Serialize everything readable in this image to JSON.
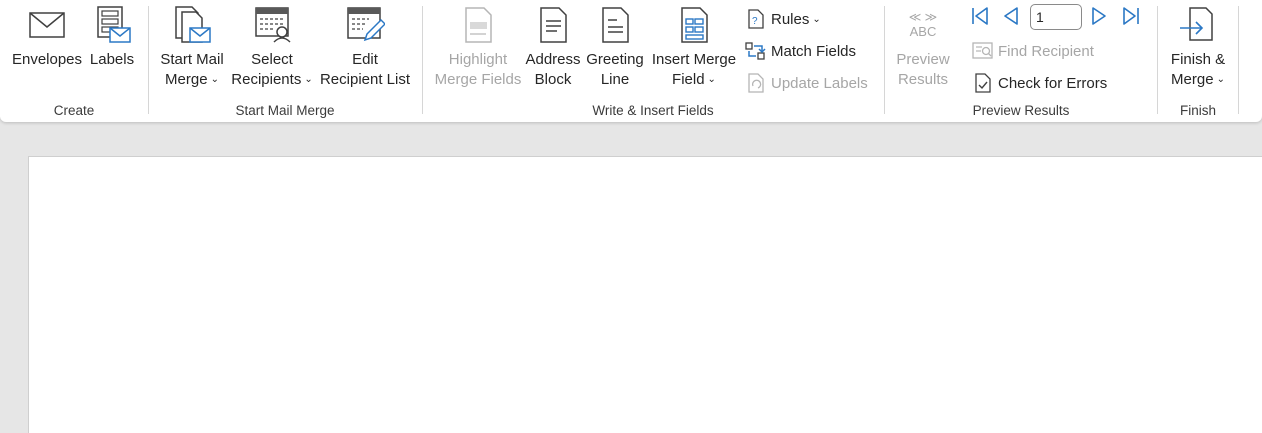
{
  "groups": {
    "create": {
      "label": "Create",
      "envelopes": [
        "Envelopes"
      ],
      "labels": [
        "Labels"
      ]
    },
    "start_mail_merge": {
      "label": "Start Mail Merge",
      "start_mail_merge": [
        "Start Mail",
        "Merge"
      ],
      "select_recipients": [
        "Select",
        "Recipients"
      ],
      "edit_recipient_list": [
        "Edit",
        "Recipient List"
      ]
    },
    "write_insert": {
      "label": "Write & Insert Fields",
      "highlight_merge_fields": [
        "Highlight",
        "Merge Fields"
      ],
      "address_block": [
        "Address",
        "Block"
      ],
      "greeting_line": [
        "Greeting",
        "Line"
      ],
      "insert_merge_field": [
        "Insert Merge",
        "Field"
      ],
      "rules": "Rules",
      "match_fields": "Match Fields",
      "update_labels": "Update Labels"
    },
    "preview_results": {
      "label": "Preview Results",
      "preview_glyph": "≪ ≫",
      "preview_abc": "ABC",
      "preview_results": [
        "Preview",
        "Results"
      ],
      "record_number": "1",
      "find_recipient": "Find Recipient",
      "check_for_errors": "Check for Errors"
    },
    "finish": {
      "label": "Finish",
      "finish_merge": [
        "Finish &",
        "Merge"
      ]
    }
  },
  "colors": {
    "accent": "#2b78c5",
    "disabled": "#a6a6a6",
    "text": "#262626"
  },
  "icons": {
    "envelopes": "envelope-icon",
    "labels": "labels-icon",
    "start_mail_merge": "start-mail-merge-icon",
    "select_recipients": "select-recipients-icon",
    "edit_recipient_list": "edit-recipient-list-icon",
    "highlight_merge_fields": "highlight-merge-fields-icon",
    "address_block": "address-block-icon",
    "greeting_line": "greeting-line-icon",
    "insert_merge_field": "insert-merge-field-icon",
    "rules": "rules-icon",
    "match_fields": "match-fields-icon",
    "update_labels": "update-labels-icon",
    "first_record": "first-record-icon",
    "previous_record": "previous-record-icon",
    "next_record": "next-record-icon",
    "last_record": "last-record-icon",
    "find_recipient": "find-recipient-icon",
    "check_for_errors": "check-for-errors-icon",
    "finish_merge": "finish-merge-icon"
  }
}
